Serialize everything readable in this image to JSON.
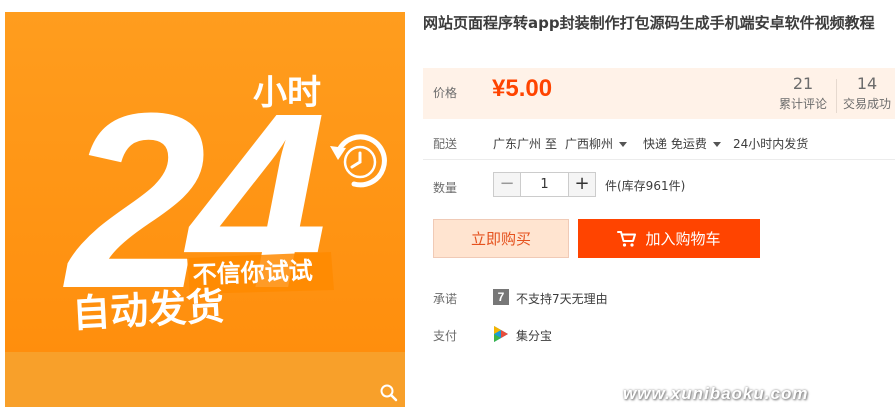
{
  "product_image": {
    "numeral": "24",
    "hours_text": "小时",
    "tagline": "不信你试试",
    "headline": "自动发货",
    "zoom_icon": "search-icon",
    "colors": {
      "background": "#ff8c0a",
      "band": "#f8a02a",
      "text": "#ffffff"
    }
  },
  "title": "网站页面程序转app封装制作打包源码生成手机端安卓软件视频教程",
  "price": {
    "label": "价格",
    "value": "¥5.00",
    "reviews_count": "21",
    "reviews_label": "累计评论",
    "sales_count": "14",
    "sales_label": "交易成功"
  },
  "delivery": {
    "label": "配送",
    "from": "广东广州",
    "to_word": "至",
    "to": "广西柳州",
    "method": "快递 免运费",
    "ship_time": "24小时内发货"
  },
  "quantity": {
    "label": "数量",
    "minus": "−",
    "value": "1",
    "plus": "+",
    "stock": "件(库存961件)"
  },
  "buttons": {
    "buy_now": "立即购买",
    "add_to_cart": "加入购物车",
    "cart_icon": "cart-icon"
  },
  "promise": {
    "label": "承诺",
    "icon_text": "7",
    "text": "不支持7天无理由"
  },
  "payment": {
    "label": "支付",
    "icon": "jifenbao-icon",
    "text": "集分宝"
  },
  "watermark": "www.xunibaoku.com",
  "colors": {
    "accent": "#ff4400",
    "price": "#ff4400",
    "price_box": "#fff2e8"
  }
}
